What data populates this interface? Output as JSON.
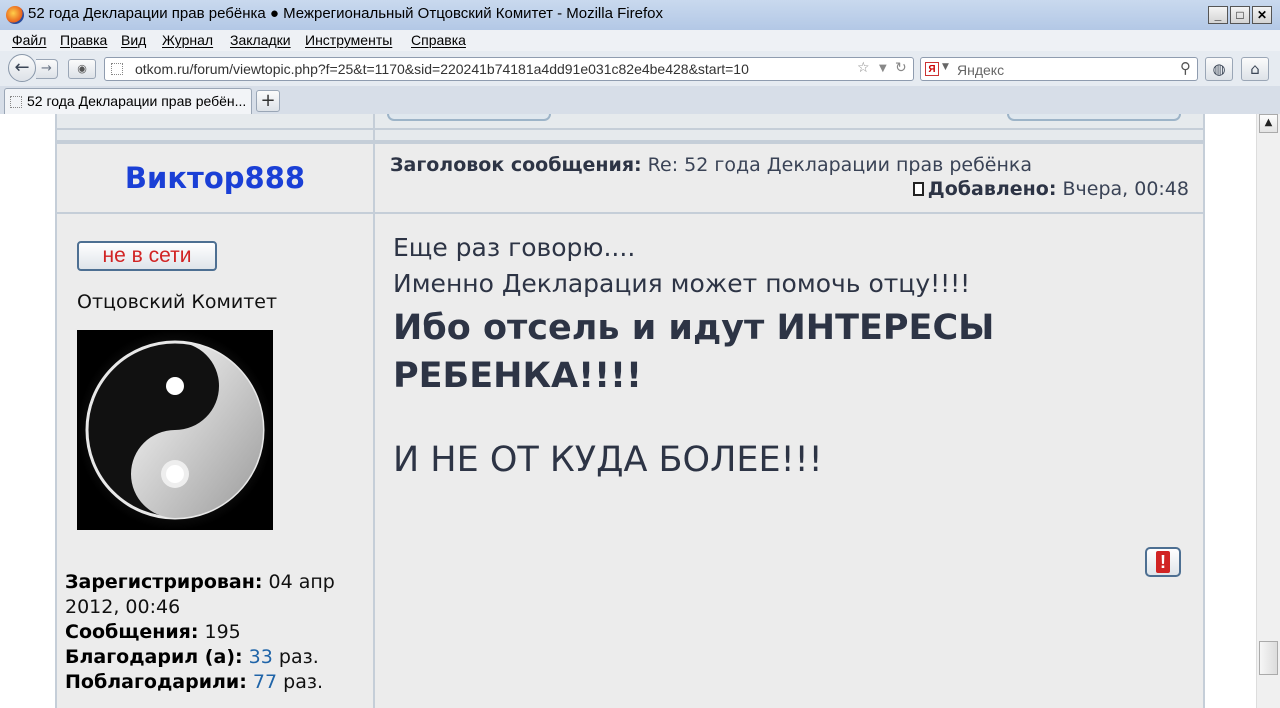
{
  "window": {
    "title": "52 года Декларации прав ребёнка ● Межрегиональный Отцовский Комитет - Mozilla Firefox",
    "controls": [
      "_",
      "□",
      "✕"
    ]
  },
  "menu": [
    "Файл",
    "Правка",
    "Вид",
    "Журнал",
    "Закладки",
    "Инструменты",
    "Справка"
  ],
  "nav": {
    "url": "otkom.ru/forum/viewtopic.php?f=25&t=1170&sid=220241b74181a4dd91e031c82e4be428&start=10",
    "search_placeholder": "Яндекс",
    "search_engine_letter": "Я"
  },
  "tabs": [
    {
      "label": "52 года Декларации прав ребён..."
    }
  ],
  "post": {
    "author": "Виктор888",
    "subject_label": "Заголовок сообщения:",
    "subject": "Re: 52 года Декларации прав ребёнка",
    "added_label": "Добавлено:",
    "added": "Вчера, 00:48",
    "status": "не в сети",
    "rank": "Отцовский Комитет",
    "registered_label": "Зарегистрирован:",
    "registered": "04 апр 2012, 00:46",
    "messages_label": "Сообщения:",
    "messages": "195",
    "thanked_label": "Благодарил (а):",
    "thanked": "33",
    "thanked_suffix": "раз.",
    "was_thanked_label": "Поблагодарили:",
    "was_thanked": "77",
    "was_thanked_suffix": "раз.",
    "body": {
      "line1": "Еще раз говорю....",
      "line2": "Именно Декларация может помочь отцу!!!!",
      "line3": "Ибо отсель и идут ИНТЕРЕСЫ РЕБЕНКА!!!!",
      "line4": "И НЕ ОТ КУДА БОЛЕЕ!!!"
    },
    "report_glyph": "!"
  }
}
